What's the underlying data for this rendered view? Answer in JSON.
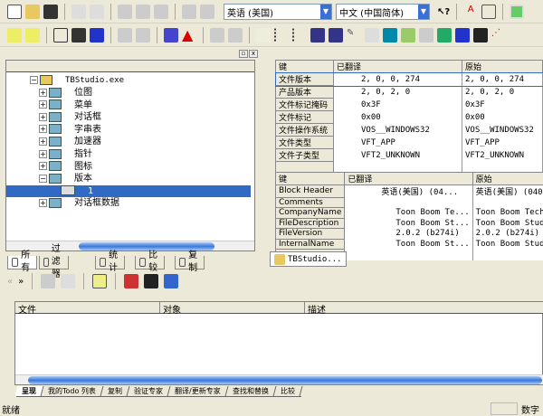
{
  "toolbar1": {
    "source_language": "英语 (美国)",
    "target_language": "中文 (中国简体)",
    "icons": [
      "new-file-icon",
      "open-folder-icon",
      "save-icon",
      "undo-icon",
      "redo-icon",
      "cut-icon",
      "copy-icon",
      "paste-icon",
      "cmd1-icon",
      "cmd2-icon"
    ]
  },
  "toolbar2": {
    "icons": [
      "expand-icon",
      "collapse-icon",
      "font-icon",
      "dictionary-icon",
      "translate-icon",
      "doc1-icon",
      "doc2-icon",
      "validate-icon",
      "warning-icon",
      "doc3-icon",
      "doc4-icon",
      "notes-icon",
      "checklist-icon",
      "checklist2-icon",
      "people-icon",
      "people2-icon",
      "pin-icon",
      "search-icon",
      "refresh-icon",
      "edit-icon",
      "copy2-icon",
      "globe-icon",
      "translate2-icon",
      "binoculars-icon",
      "link-icon"
    ]
  },
  "tree": {
    "root": "TBStudio.exe",
    "items": [
      {
        "label": "位图"
      },
      {
        "label": "菜单"
      },
      {
        "label": "对话框"
      },
      {
        "label": "字串表"
      },
      {
        "label": "加速器"
      },
      {
        "label": "指针"
      },
      {
        "label": "图标"
      },
      {
        "label": "版本"
      },
      {
        "label": "1",
        "selected": true
      },
      {
        "label": "对话框数据"
      }
    ]
  },
  "left_tabs": [
    "所有",
    "过滤器",
    "统计",
    "比较",
    "复制"
  ],
  "version_table": {
    "headers": [
      "键",
      "已翻译",
      "原始"
    ],
    "rows": [
      [
        "文件版本",
        "2, 0, 0, 274",
        "2, 0, 0, 274"
      ],
      [
        "产品版本",
        "2, 0, 2, 0",
        "2, 0, 2, 0"
      ],
      [
        "文件标记掩码",
        "0x3F",
        "0x3F"
      ],
      [
        "文件标记",
        "0x00",
        "0x00"
      ],
      [
        "文件操作系统",
        "VOS__WINDOWS32",
        "VOS__WINDOWS32"
      ],
      [
        "文件类型",
        "VFT_APP",
        "VFT_APP"
      ],
      [
        "文件子类型",
        "VFT2_UNKNOWN",
        "VFT2_UNKNOWN"
      ]
    ]
  },
  "string_table": {
    "headers": [
      "键",
      "已翻译",
      "原始"
    ],
    "rows": [
      [
        "Block Header",
        "英语(美国) (04...",
        "英语(美国) (040"
      ],
      [
        "Comments",
        "",
        ""
      ],
      [
        "CompanyName",
        "Toon Boom Te...",
        "Toon Boom Techn"
      ],
      [
        "FileDescription",
        "Toon Boom St...",
        "Toon Boom Studi"
      ],
      [
        "FileVersion",
        "2.0.2 (b274i)",
        "2.0.2 (b274i)"
      ],
      [
        "InternalName",
        "Toon Boom St...",
        "Toon Boom Studi"
      ]
    ]
  },
  "doc_tab": "TBStudio...",
  "output_headers": [
    "文件",
    "对象",
    "描述"
  ],
  "bottom_tabs": [
    "呈现",
    "我的Todo 列表",
    "复制",
    "验证专家",
    "翻译/更新专家",
    "查找和替换",
    "比较"
  ],
  "status": {
    "text": "就绪",
    "num": "数字"
  },
  "colors": {
    "selection": "#316ac5",
    "accent": "#3a6fd8"
  }
}
